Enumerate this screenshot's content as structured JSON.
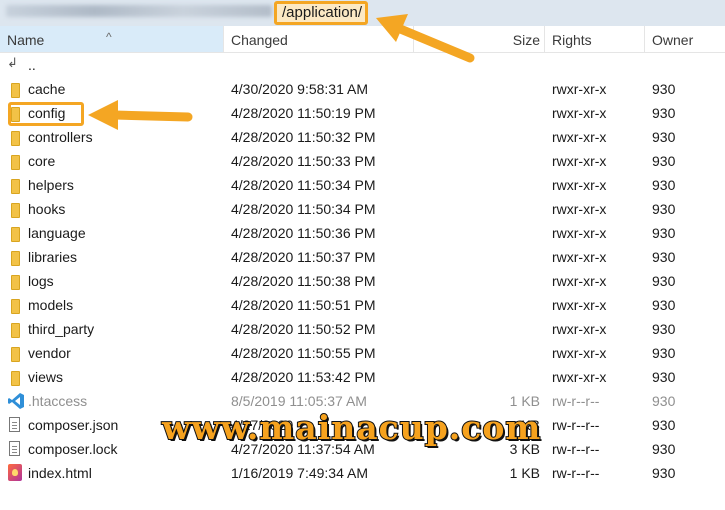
{
  "path": {
    "highlighted_segment": "/application/"
  },
  "columns": {
    "name": "Name",
    "changed": "Changed",
    "size": "Size",
    "rights": "Rights",
    "owner": "Owner"
  },
  "colors": {
    "accent": "#f4a623",
    "selected_header": "#d9ebf9",
    "folder": "#f2c247"
  },
  "files": [
    {
      "icon": "up-directory-icon",
      "name": "..",
      "changed": "",
      "size": "",
      "rights": "",
      "owner": ""
    },
    {
      "icon": "folder-icon",
      "name": "cache",
      "changed": "4/30/2020 9:58:31 AM",
      "size": "",
      "rights": "rwxr-xr-x",
      "owner": "930"
    },
    {
      "icon": "folder-icon",
      "name": "config",
      "changed": "4/28/2020 11:50:19 PM",
      "size": "",
      "rights": "rwxr-xr-x",
      "owner": "930"
    },
    {
      "icon": "folder-icon",
      "name": "controllers",
      "changed": "4/28/2020 11:50:32 PM",
      "size": "",
      "rights": "rwxr-xr-x",
      "owner": "930"
    },
    {
      "icon": "folder-icon",
      "name": "core",
      "changed": "4/28/2020 11:50:33 PM",
      "size": "",
      "rights": "rwxr-xr-x",
      "owner": "930"
    },
    {
      "icon": "folder-icon",
      "name": "helpers",
      "changed": "4/28/2020 11:50:34 PM",
      "size": "",
      "rights": "rwxr-xr-x",
      "owner": "930"
    },
    {
      "icon": "folder-icon",
      "name": "hooks",
      "changed": "4/28/2020 11:50:34 PM",
      "size": "",
      "rights": "rwxr-xr-x",
      "owner": "930"
    },
    {
      "icon": "folder-icon",
      "name": "language",
      "changed": "4/28/2020 11:50:36 PM",
      "size": "",
      "rights": "rwxr-xr-x",
      "owner": "930"
    },
    {
      "icon": "folder-icon",
      "name": "libraries",
      "changed": "4/28/2020 11:50:37 PM",
      "size": "",
      "rights": "rwxr-xr-x",
      "owner": "930"
    },
    {
      "icon": "folder-icon",
      "name": "logs",
      "changed": "4/28/2020 11:50:38 PM",
      "size": "",
      "rights": "rwxr-xr-x",
      "owner": "930"
    },
    {
      "icon": "folder-icon",
      "name": "models",
      "changed": "4/28/2020 11:50:51 PM",
      "size": "",
      "rights": "rwxr-xr-x",
      "owner": "930"
    },
    {
      "icon": "folder-icon",
      "name": "third_party",
      "changed": "4/28/2020 11:50:52 PM",
      "size": "",
      "rights": "rwxr-xr-x",
      "owner": "930"
    },
    {
      "icon": "folder-icon",
      "name": "vendor",
      "changed": "4/28/2020 11:50:55 PM",
      "size": "",
      "rights": "rwxr-xr-x",
      "owner": "930"
    },
    {
      "icon": "folder-icon",
      "name": "views",
      "changed": "4/28/2020 11:53:42 PM",
      "size": "",
      "rights": "rwxr-xr-x",
      "owner": "930"
    },
    {
      "icon": "vscode-file-icon",
      "name": ".htaccess",
      "changed": "8/5/2019 11:05:37 AM",
      "size": "1 KB",
      "rights": "rw-r--r--",
      "owner": "930",
      "dim": true
    },
    {
      "icon": "document-icon",
      "name": "composer.json",
      "changed": "4/27/2020",
      "size": "KB",
      "rights": "rw-r--r--",
      "owner": "930"
    },
    {
      "icon": "document-icon",
      "name": "composer.lock",
      "changed": "4/27/2020 11:37:54 AM",
      "size": "3 KB",
      "rights": "rw-r--r--",
      "owner": "930"
    },
    {
      "icon": "html-file-icon",
      "name": "index.html",
      "changed": "1/16/2019 7:49:34 AM",
      "size": "1 KB",
      "rights": "rw-r--r--",
      "owner": "930"
    }
  ],
  "watermark": "www.mainacup.com"
}
